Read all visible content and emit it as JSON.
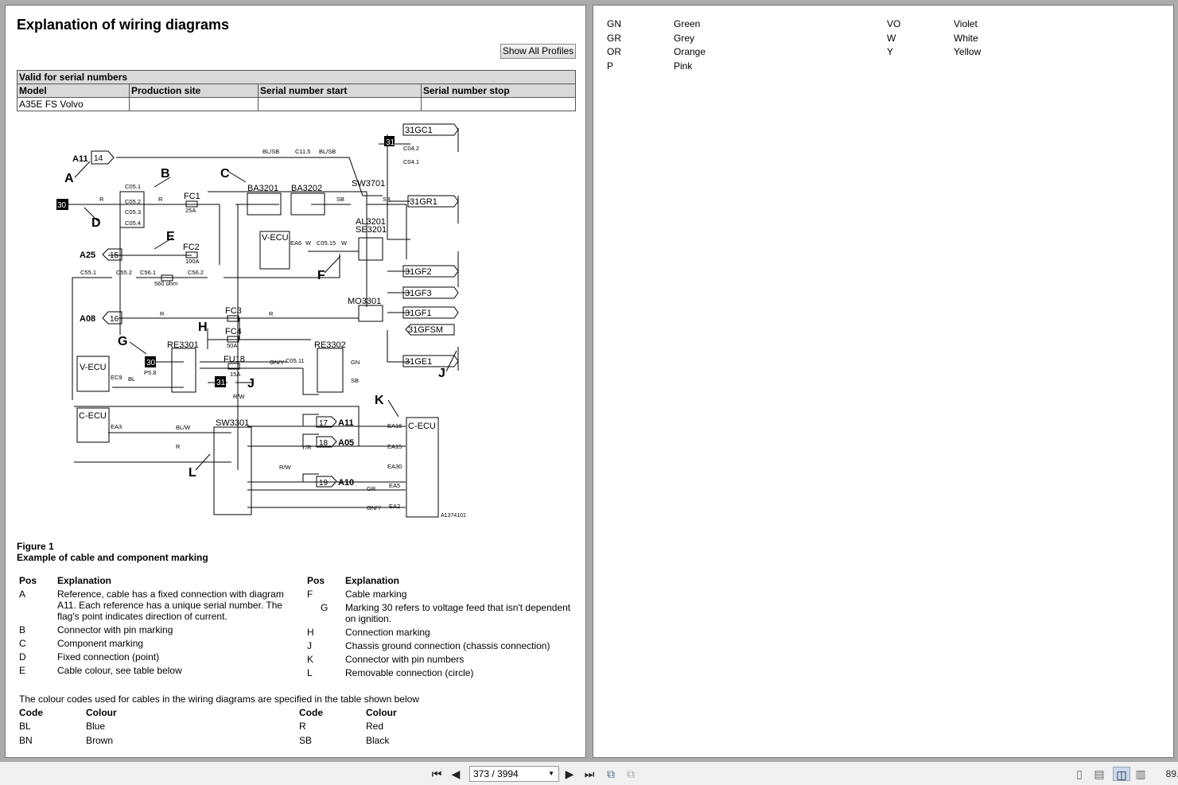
{
  "document": {
    "title": "Explanation of wiring diagrams",
    "show_all_profiles": "Show All Profiles",
    "serial_table": {
      "caption": "Valid for serial numbers",
      "headers": [
        "Model",
        "Production site",
        "Serial number start",
        "Serial number stop"
      ],
      "rows": [
        [
          "A35E FS Volvo",
          "",
          "",
          ""
        ]
      ]
    },
    "figure": {
      "number": "Figure 1",
      "caption": "Example of cable and component marking"
    },
    "explanations": {
      "headers": [
        "Pos",
        "Explanation"
      ],
      "left": [
        [
          "A",
          "Reference, cable has a fixed connection with diagram A11. Each reference has a unique serial number. The flag's point indicates direction of current."
        ],
        [
          "B",
          "Connector with pin marking"
        ],
        [
          "C",
          "Component marking"
        ],
        [
          "D",
          "Fixed connection (point)"
        ],
        [
          "E",
          "Cable colour, see table below"
        ]
      ],
      "right": [
        [
          "F",
          "Cable marking"
        ],
        [
          "G",
          "Marking 30 refers to voltage feed that isn't dependent on ignition."
        ],
        [
          "H",
          "Connection marking"
        ],
        [
          "J",
          "Chassis ground connection (chassis connection)"
        ],
        [
          "K",
          "Connector with pin numbers"
        ],
        [
          "L",
          "Removable connection (circle)"
        ]
      ]
    },
    "colour_intro": "The colour codes used for cables in the wiring diagrams are specified in the table shown below",
    "colour_headers": [
      "Code",
      "Colour"
    ],
    "colours_left": [
      [
        "BL",
        "Blue"
      ],
      [
        "BN",
        "Brown"
      ]
    ],
    "colours_right": [
      [
        "R",
        "Red"
      ],
      [
        "SB",
        "Black"
      ]
    ],
    "colours_page2_left": [
      [
        "GN",
        "Green"
      ],
      [
        "GR",
        "Grey"
      ],
      [
        "OR",
        "Orange"
      ],
      [
        "P",
        "Pink"
      ]
    ],
    "colours_page2_right": [
      [
        "VO",
        "Violet"
      ],
      [
        "W",
        "White"
      ],
      [
        "Y",
        "Yellow"
      ]
    ]
  },
  "diagram": {
    "letters": [
      "A",
      "B",
      "C",
      "D",
      "E",
      "F",
      "G",
      "H",
      "J",
      "J",
      "K",
      "L"
    ],
    "components": [
      "A11",
      "BA3201",
      "BA3202",
      "FC1",
      "FC2",
      "SW3701",
      "AL3201",
      "SE3201",
      "V-ECU",
      "MO3301",
      "FC3",
      "FC4",
      "RE3301",
      "RE3302",
      "FU18",
      "V-ECU",
      "C-ECU",
      "SW3301",
      "C-ECU",
      "A25",
      "A08",
      "A11",
      "A05",
      "A10",
      "A1374101"
    ],
    "grounds": [
      "31GC1",
      "31GR1",
      "31GF2",
      "31GF3",
      "31GF1",
      "31GFSM",
      "31GE1"
    ],
    "boxes": [
      "30",
      "31",
      "30",
      "31"
    ],
    "flags": [
      "14",
      "15",
      "16",
      "17",
      "18",
      "19"
    ],
    "wire_labels": [
      "BL/SB",
      "C11.5",
      "BL/SB",
      "R",
      "R",
      "25A",
      "100A",
      "SB",
      "SB",
      "W",
      "C05.15",
      "W",
      "C55.1",
      "C55.2",
      "C56.1",
      "C56.2",
      "560 ohm",
      "R",
      "R",
      "50A",
      "15A",
      "GN/Y",
      "C05.11",
      "GN",
      "SB",
      "BL",
      "P5.8",
      "R/W",
      "BL/W",
      "R",
      "Y/R",
      "R/W",
      "GR",
      "GN/Y",
      "EA16",
      "EA15",
      "EA30",
      "EA5",
      "EA2",
      "EA3",
      "EC9",
      "EA6",
      "C05.1",
      "C05.2",
      "C05.3",
      "C05.4",
      "C04.2",
      "C04.1"
    ]
  },
  "toolbar": {
    "page": "373 / 3994",
    "zoom": "89.",
    "icons": [
      "first-page-icon",
      "prev-page-icon",
      "next-page-icon",
      "last-page-icon",
      "rotate-icon",
      "copy-icon",
      "single-page-icon",
      "continuous-icon",
      "facing-icon",
      "facing-continuous-icon"
    ]
  }
}
